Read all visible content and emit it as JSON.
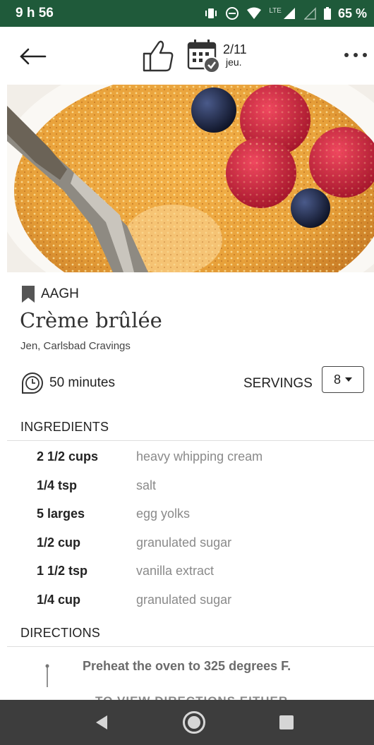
{
  "status": {
    "time": "9 h 56",
    "network": "LTE",
    "battery": "65 %"
  },
  "header": {
    "icons": [
      "back-arrow-icon",
      "thumbs-up-icon",
      "calendar-check-icon",
      "more-icon"
    ],
    "date_day": "2/11",
    "date_weekday": "jeu."
  },
  "hero": {
    "subject": "crème brûlée with raspberries and blueberries",
    "accent_colors": [
      "#e8a13a",
      "#c51f3a",
      "#1c2340"
    ]
  },
  "recipe": {
    "collection": "AAGH",
    "title": "Crème brûlée",
    "author": "Jen, Carlsbad Cravings",
    "time": "50 minutes",
    "servings_label": "SERVINGS",
    "servings_value": "8"
  },
  "ingredients": {
    "heading": "INGREDIENTS",
    "items": [
      {
        "qty": "2 1/2 cups",
        "name": "heavy whipping cream"
      },
      {
        "qty": "1/4 tsp",
        "name": "salt"
      },
      {
        "qty": "5 larges",
        "name": "egg yolks"
      },
      {
        "qty": "1/2 cup",
        "name": "granulated sugar"
      },
      {
        "qty": "1 1/2 tsp",
        "name": "vanilla extract"
      },
      {
        "qty": "1/4 cup",
        "name": "granulated sugar"
      }
    ]
  },
  "directions": {
    "heading": "DIRECTIONS",
    "steps": [
      "Preheat the oven to 325 degrees F."
    ],
    "peek_text": "TO VIEW DIRECTIONS EITHER"
  },
  "colors": {
    "status_bar": "#1f5a3a",
    "nav_bar": "#3d3d3d"
  }
}
